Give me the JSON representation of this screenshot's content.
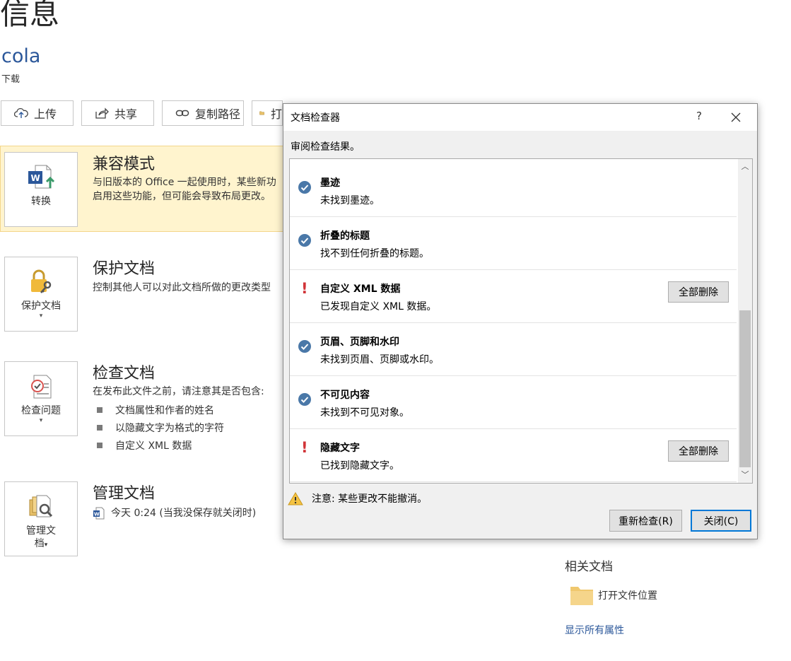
{
  "page": {
    "title": "信息",
    "doc_name": "cola",
    "doc_path": "下载"
  },
  "toolbar": {
    "upload": "上传",
    "share": "共享",
    "copy_path": "复制路径",
    "open_location_partial": "打"
  },
  "compat": {
    "button": "转换",
    "title": "兼容模式",
    "desc_line1": "与旧版本的 Office 一起使用时，某些新功",
    "desc_line2": "启用这些功能，但可能会导致布局更改。"
  },
  "protect": {
    "button": "保护文档",
    "title": "保护文档",
    "desc": "控制其他人可以对此文档所做的更改类型"
  },
  "inspect": {
    "button": "检查问题",
    "title": "检查文档",
    "desc": "在发布此文件之前，请注意其是否包含:",
    "bullets": [
      "文档属性和作者的姓名",
      "以隐藏文字为格式的字符",
      "自定义 XML 数据"
    ]
  },
  "manage": {
    "button_line1": "管理文",
    "button_line2": "档",
    "title": "管理文档",
    "version": "今天 0:24 (当我没保存就关闭时)"
  },
  "related": {
    "title": "相关文档",
    "open_location": "打开文件位置",
    "show_all": "显示所有属性"
  },
  "dialog": {
    "title": "文档检查器",
    "help": "?",
    "subtitle": "审阅检查结果。",
    "results": [
      {
        "status": "ok",
        "title": "墨迹",
        "desc": "未找到墨迹。"
      },
      {
        "status": "ok",
        "title": "折叠的标题",
        "desc": "找不到任何折叠的标题。"
      },
      {
        "status": "warn",
        "title": "自定义 XML 数据",
        "desc": "已发现自定义 XML 数据。",
        "action": "全部删除"
      },
      {
        "status": "ok",
        "title": "页眉、页脚和水印",
        "desc": "未找到页眉、页脚或水印。"
      },
      {
        "status": "ok",
        "title": "不可见内容",
        "desc": "未找到不可见对象。"
      },
      {
        "status": "warn",
        "title": "隐藏文字",
        "desc": "已找到隐藏文字。",
        "action": "全部删除"
      }
    ],
    "note": "注意: 某些更改不能撤消。",
    "recheck": "重新检查(R)",
    "close": "关闭(C)"
  },
  "colors": {
    "accent": "#2b579a",
    "compat_bg": "#fff4ce",
    "ok_icon": "#4a78a8",
    "warn_icon": "#d13438",
    "focus_border": "#0078d7"
  }
}
